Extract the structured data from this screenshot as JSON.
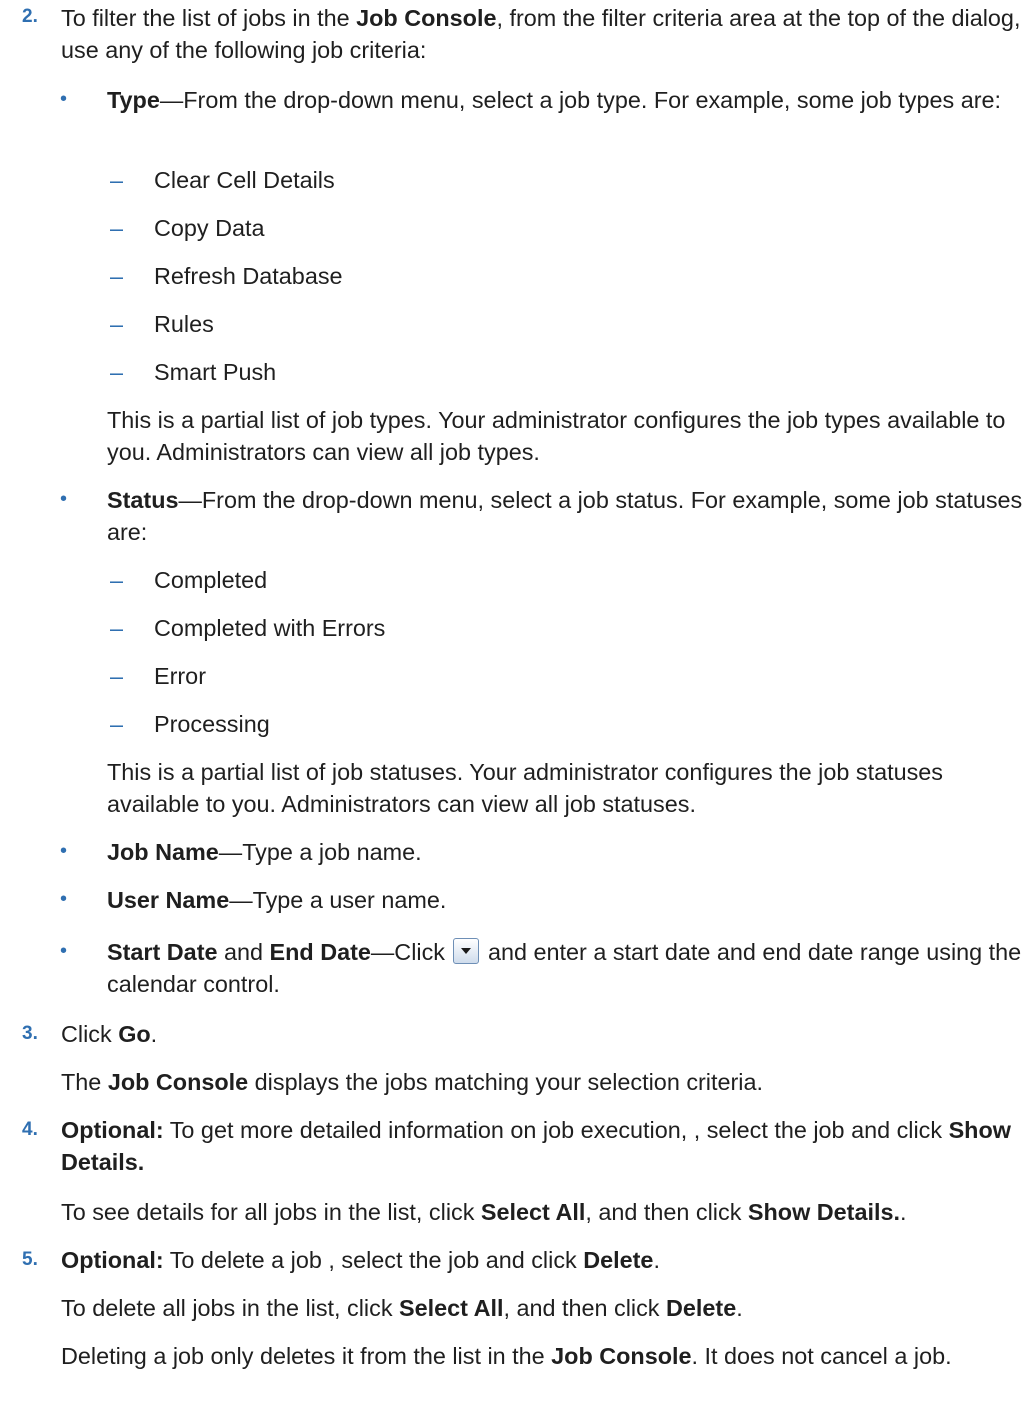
{
  "step2": {
    "number": "2.",
    "intro": [
      "To filter the list of jobs in the ",
      "Job Console",
      ", from the filter criteria area at the top of the dialog, use any of the following job criteria:"
    ],
    "type": {
      "term": "Type",
      "text": "—From the drop-down menu, select a job type. For example, some job types are:",
      "items": [
        "Clear Cell Details",
        "Copy Data",
        "Refresh Database",
        "Rules",
        "Smart Push"
      ],
      "note": "This is a partial list of job types. Your administrator configures the job types available to you. Administrators can view all job types."
    },
    "status": {
      "term": "Status",
      "text": "—From the drop-down menu, select a job status. For example, some job statuses are:",
      "items": [
        "Completed",
        "Completed with Errors",
        "Error",
        "Processing"
      ],
      "note": "This is a partial list of job statuses. Your administrator configures the job statuses available to you. Administrators can view all job statuses."
    },
    "job_name": {
      "term": "Job Name",
      "text": "—Type a job name."
    },
    "user_name": {
      "term": "User Name",
      "text": "—Type a user name."
    },
    "dates": {
      "term1": "Start Date",
      "and": " and ",
      "term2": "End Date",
      "text_a": "—Click ",
      "icon": "dropdown-arrow-icon",
      "text_b": " and enter a start date and end date range using the calendar control."
    }
  },
  "step3": {
    "number": "3.",
    "pre": "Click ",
    "bold": "Go",
    "post": ".",
    "result": [
      "The ",
      "Job Console",
      " displays the jobs matching your selection criteria."
    ]
  },
  "step4": {
    "number": "4.",
    "optional": "Optional:",
    "text_a": " To get more detailed information on job execution, , select the job and click ",
    "bold_a": "Show Details.",
    "p2": [
      "To see details for all jobs in the list, click ",
      "Select All",
      ", and then click ",
      "Show Details.",
      "."
    ]
  },
  "step5": {
    "number": "5.",
    "optional": "Optional:",
    "text_a": " To delete a job , select the job and click ",
    "bold_a": "Delete",
    "post": ".",
    "p2": [
      "To delete all jobs in the list, click ",
      "Select All",
      ", and then click ",
      "Delete",
      "."
    ],
    "p3": [
      "Deleting a job only deletes it from the list in the ",
      "Job Console",
      ". It does not cancel a job."
    ]
  },
  "colors": {
    "marker": "#2f6fb1",
    "text": "#1f1f1f"
  }
}
